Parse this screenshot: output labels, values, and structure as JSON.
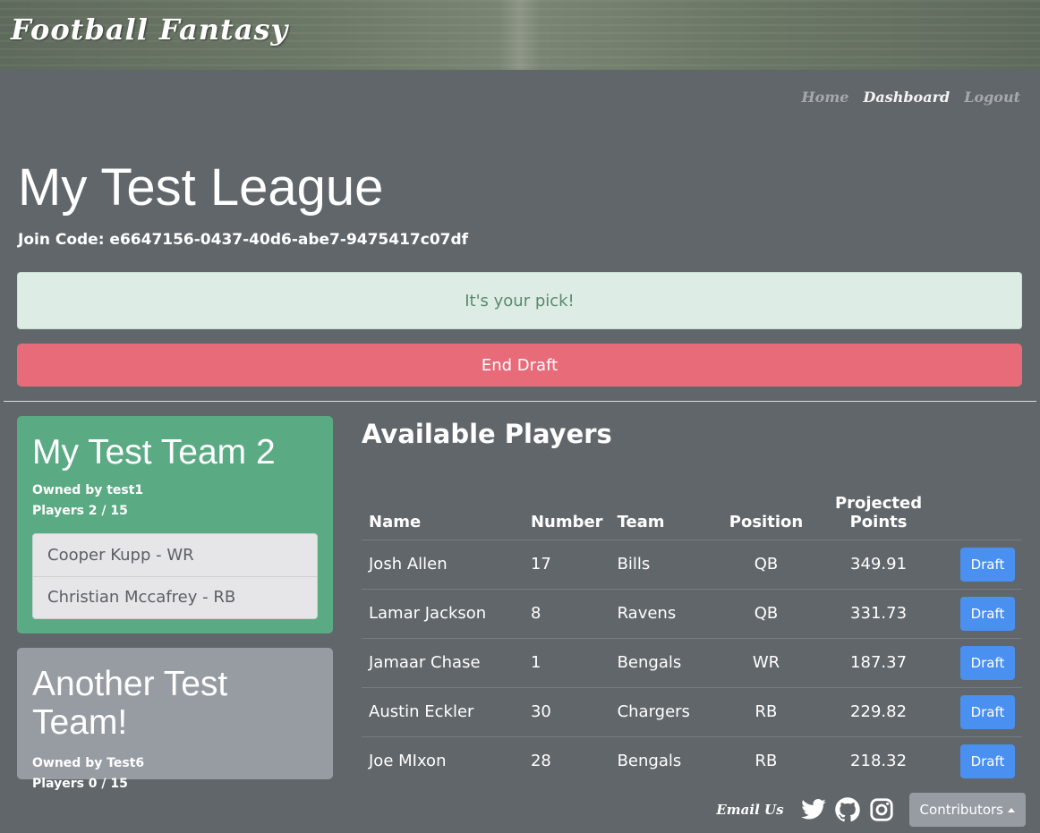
{
  "header": {
    "title": "Football Fantasy",
    "nav": {
      "home": "Home",
      "dashboard": "Dashboard",
      "logout": "Logout"
    }
  },
  "league": {
    "title": "My Test League",
    "join_code": "Join Code: e6647156-0437-40d6-abe7-9475417c07df"
  },
  "alert": {
    "text": "It's your pick!"
  },
  "end_draft_label": "End Draft",
  "teams": [
    {
      "name": "My Test Team 2",
      "owner": "Owned by test1",
      "players": "Players 2 / 15",
      "roster": [
        "Cooper Kupp - WR",
        "Christian Mccafrey - RB"
      ]
    },
    {
      "name": "Another Test Team!",
      "owner": "Owned by Test6",
      "players": "Players 0 / 15",
      "roster": []
    }
  ],
  "available": {
    "heading": "Available Players",
    "columns": {
      "name": "Name",
      "number": "Number",
      "team": "Team",
      "position": "Position",
      "points_line1": "Projected",
      "points_line2": "Points"
    },
    "draft_label": "Draft",
    "rows": [
      {
        "name": "Josh Allen",
        "number": "17",
        "team": "Bills",
        "position": "QB",
        "points": "349.91"
      },
      {
        "name": "Lamar Jackson",
        "number": "8",
        "team": "Ravens",
        "position": "QB",
        "points": "331.73"
      },
      {
        "name": "Jamaar Chase",
        "number": "1",
        "team": "Bengals",
        "position": "WR",
        "points": "187.37"
      },
      {
        "name": "Austin Eckler",
        "number": "30",
        "team": "Chargers",
        "position": "RB",
        "points": "229.82"
      },
      {
        "name": "Joe MIxon",
        "number": "28",
        "team": "Bengals",
        "position": "RB",
        "points": "218.32"
      }
    ]
  },
  "footer": {
    "email_us": "Email Us",
    "contributors_label": "Contributors",
    "icons": [
      "twitter-icon",
      "github-icon",
      "instagram-icon"
    ]
  },
  "colors": {
    "page_bg": "#61666b",
    "team_owned_bg": "#5aaa84",
    "team_other_bg": "#979ca3",
    "alert_bg": "#ddece5",
    "end_draft_bg": "#e86b7a",
    "draft_button_bg": "#4a90f0"
  }
}
